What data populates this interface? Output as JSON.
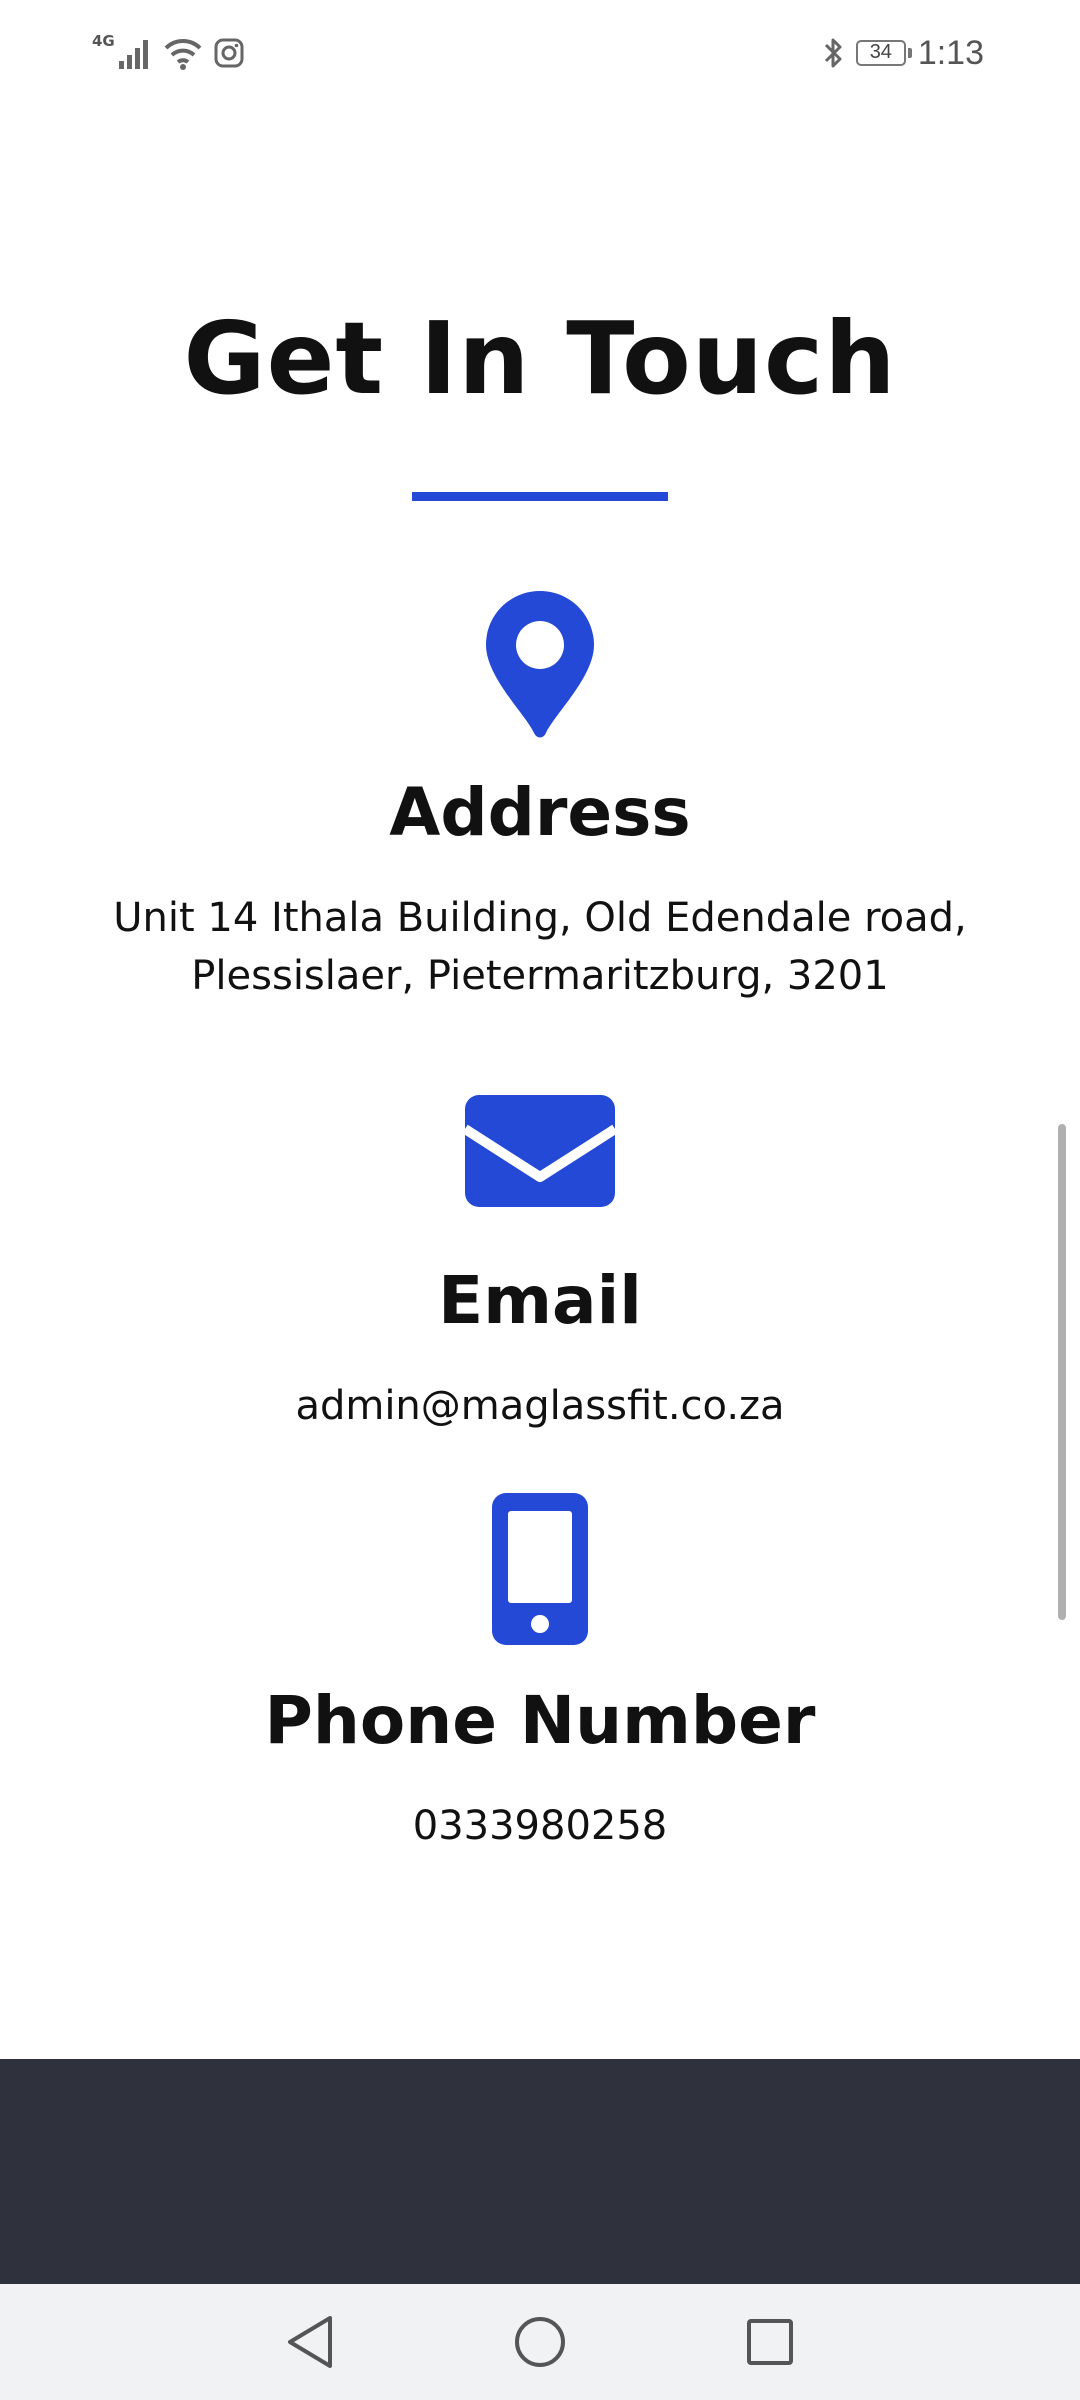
{
  "status_bar": {
    "network": "4G",
    "time": "1:13",
    "battery": "34",
    "icons": [
      "signal-icon",
      "wifi-icon",
      "instagram-icon",
      "bluetooth-icon",
      "battery-icon"
    ]
  },
  "contact": {
    "title": "Get In Touch",
    "accent_color": "#2449d6",
    "address": {
      "icon": "map-pin-icon",
      "heading": "Address",
      "line1": "Unit 14 Ithala Building, Old Edendale road,",
      "line2": "Plessislaer, Pietermaritzburg, 3201"
    },
    "email": {
      "icon": "envelope-icon",
      "heading": "Email",
      "value": "admin@maglassfit.co.za"
    },
    "phone": {
      "icon": "mobile-phone-icon",
      "heading": "Phone Number",
      "value": "0333980258"
    }
  },
  "footer": {
    "background_color": "#2f323d"
  },
  "nav_bar": {
    "buttons": [
      "back-icon",
      "home-icon",
      "recents-icon"
    ]
  }
}
